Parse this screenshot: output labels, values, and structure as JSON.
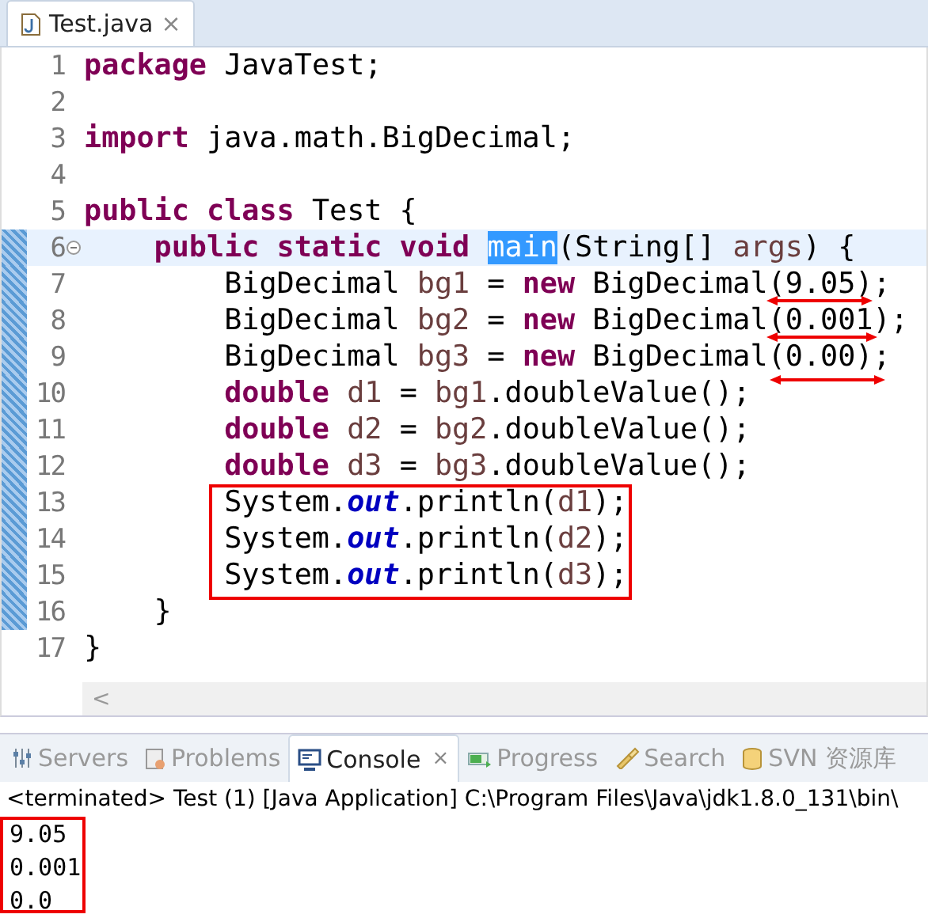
{
  "editor": {
    "tab": {
      "title": "Test.java",
      "close": "×"
    },
    "lines": [
      {
        "number": "1",
        "changed": false,
        "current": false,
        "foldable": false,
        "tokens": [
          {
            "kind": "kw",
            "text": "package"
          },
          {
            "kind": "plain",
            "text": " JavaTest;"
          }
        ]
      },
      {
        "number": "2",
        "changed": false,
        "current": false,
        "foldable": false
      },
      {
        "number": "3",
        "changed": false,
        "current": false,
        "foldable": false,
        "tokens": [
          {
            "kind": "kw",
            "text": "import"
          },
          {
            "kind": "plain",
            "text": " java.math.BigDecimal;"
          }
        ]
      },
      {
        "number": "4",
        "changed": false,
        "current": false,
        "foldable": false
      },
      {
        "number": "5",
        "changed": false,
        "current": false,
        "foldable": false,
        "tokens": [
          {
            "kind": "kw",
            "text": "public class"
          },
          {
            "kind": "plain",
            "text": " Test {"
          }
        ]
      },
      {
        "number": "6",
        "changed": true,
        "current": true,
        "foldable": true,
        "tokens": [
          {
            "kind": "kw",
            "text": "    public static void "
          },
          {
            "kind": "selected",
            "text": "main"
          },
          {
            "kind": "plain",
            "text": "(String[] "
          },
          {
            "kind": "var",
            "text": "args"
          },
          {
            "kind": "plain",
            "text": ") {"
          }
        ]
      },
      {
        "number": "7",
        "changed": true,
        "current": false,
        "foldable": false,
        "tokens": [
          {
            "kind": "plain",
            "text": "        BigDecimal "
          },
          {
            "kind": "var",
            "text": "bg1"
          },
          {
            "kind": "plain",
            "text": " = "
          },
          {
            "kind": "kw",
            "text": "new"
          },
          {
            "kind": "plain",
            "text": " BigDecimal(9.05);"
          }
        ]
      },
      {
        "number": "8",
        "changed": true,
        "current": false,
        "foldable": false,
        "tokens": [
          {
            "kind": "plain",
            "text": "        BigDecimal "
          },
          {
            "kind": "var",
            "text": "bg2"
          },
          {
            "kind": "plain",
            "text": " = "
          },
          {
            "kind": "kw",
            "text": "new"
          },
          {
            "kind": "plain",
            "text": " BigDecimal(0.001);"
          }
        ]
      },
      {
        "number": "9",
        "changed": true,
        "current": false,
        "foldable": false,
        "tokens": [
          {
            "kind": "plain",
            "text": "        BigDecimal "
          },
          {
            "kind": "var",
            "text": "bg3"
          },
          {
            "kind": "plain",
            "text": " = "
          },
          {
            "kind": "kw",
            "text": "new"
          },
          {
            "kind": "plain",
            "text": " BigDecimal(0.00);"
          }
        ]
      },
      {
        "number": "10",
        "changed": true,
        "current": false,
        "foldable": false,
        "tokens": [
          {
            "kind": "kw",
            "text": "        double "
          },
          {
            "kind": "var",
            "text": "d1"
          },
          {
            "kind": "plain",
            "text": " = "
          },
          {
            "kind": "var",
            "text": "bg1"
          },
          {
            "kind": "plain",
            "text": ".doubleValue();"
          }
        ]
      },
      {
        "number": "11",
        "changed": true,
        "current": false,
        "foldable": false,
        "tokens": [
          {
            "kind": "kw",
            "text": "        double "
          },
          {
            "kind": "var",
            "text": "d2"
          },
          {
            "kind": "plain",
            "text": " = "
          },
          {
            "kind": "var",
            "text": "bg2"
          },
          {
            "kind": "plain",
            "text": ".doubleValue();"
          }
        ]
      },
      {
        "number": "12",
        "changed": true,
        "current": false,
        "foldable": false,
        "tokens": [
          {
            "kind": "kw",
            "text": "        double "
          },
          {
            "kind": "var",
            "text": "d3"
          },
          {
            "kind": "plain",
            "text": " = "
          },
          {
            "kind": "var",
            "text": "bg3"
          },
          {
            "kind": "plain",
            "text": ".doubleValue();"
          }
        ]
      },
      {
        "number": "13",
        "changed": true,
        "current": false,
        "foldable": false,
        "tokens": [
          {
            "kind": "plain",
            "text": "        System."
          },
          {
            "kind": "field",
            "text": "out"
          },
          {
            "kind": "plain",
            "text": ".println("
          },
          {
            "kind": "var",
            "text": "d1"
          },
          {
            "kind": "plain",
            "text": ");"
          }
        ]
      },
      {
        "number": "14",
        "changed": true,
        "current": false,
        "foldable": false,
        "tokens": [
          {
            "kind": "plain",
            "text": "        System."
          },
          {
            "kind": "field",
            "text": "out"
          },
          {
            "kind": "plain",
            "text": ".println("
          },
          {
            "kind": "var",
            "text": "d2"
          },
          {
            "kind": "plain",
            "text": ");"
          }
        ]
      },
      {
        "number": "15",
        "changed": true,
        "current": false,
        "foldable": false,
        "tokens": [
          {
            "kind": "plain",
            "text": "        System."
          },
          {
            "kind": "field",
            "text": "out"
          },
          {
            "kind": "plain",
            "text": ".println("
          },
          {
            "kind": "var",
            "text": "d3"
          },
          {
            "kind": "plain",
            "text": ");"
          }
        ]
      },
      {
        "number": "16",
        "changed": true,
        "current": false,
        "foldable": false,
        "tokens": [
          {
            "kind": "plain",
            "text": "    }"
          }
        ]
      },
      {
        "number": "17",
        "changed": false,
        "current": false,
        "foldable": false,
        "tokens": [
          {
            "kind": "plain",
            "text": "}"
          }
        ]
      }
    ],
    "scroll_left": "<"
  },
  "console": {
    "tabs": [
      {
        "label": "Servers",
        "selected": false
      },
      {
        "label": "Problems",
        "selected": false
      },
      {
        "label": "Console",
        "selected": true,
        "close": "×"
      },
      {
        "label": "Progress",
        "selected": false
      },
      {
        "label": "Search",
        "selected": false
      },
      {
        "label": "SVN 资源库",
        "selected": false
      }
    ],
    "status": "<terminated> Test (1) [Java Application] C:\\Program Files\\Java\\jdk1.8.0_131\\bin\\",
    "output": [
      "9.05",
      "0.001",
      "0.0"
    ]
  }
}
